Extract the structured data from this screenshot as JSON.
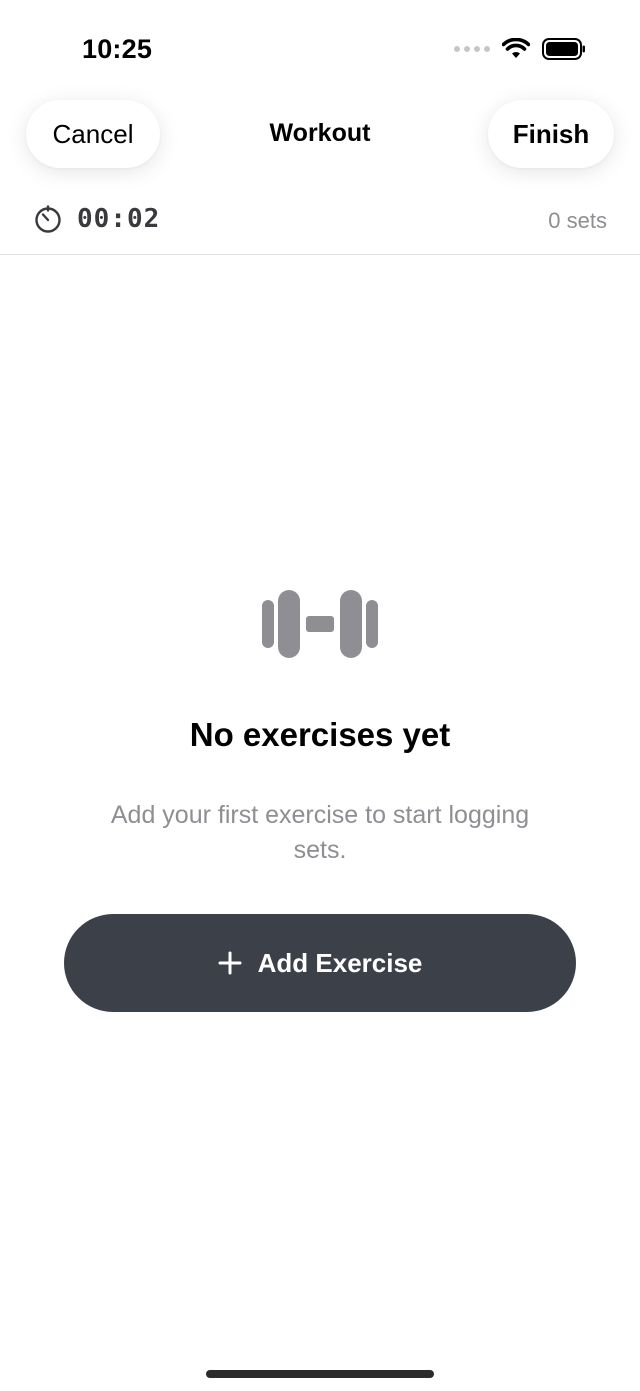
{
  "status_bar": {
    "time": "10:25",
    "icons": [
      "cellular-signal-icon",
      "wifi-icon",
      "battery-icon"
    ]
  },
  "nav": {
    "cancel_label": "Cancel",
    "title": "Workout",
    "finish_label": "Finish"
  },
  "session": {
    "icon": "timer-icon",
    "elapsed": "00:02",
    "sets_count": "0 sets"
  },
  "empty_state": {
    "icon": "dumbbell-icon",
    "title": "No exercises yet",
    "subtitle": "Add your first exercise to start logging sets."
  },
  "actions": {
    "add_exercise_label": "Add Exercise",
    "add_icon": "plus-icon"
  },
  "colors": {
    "primary_button": "#3c4048",
    "secondary_text": "#8e8e93",
    "icon_gray": "#8e8e93"
  }
}
